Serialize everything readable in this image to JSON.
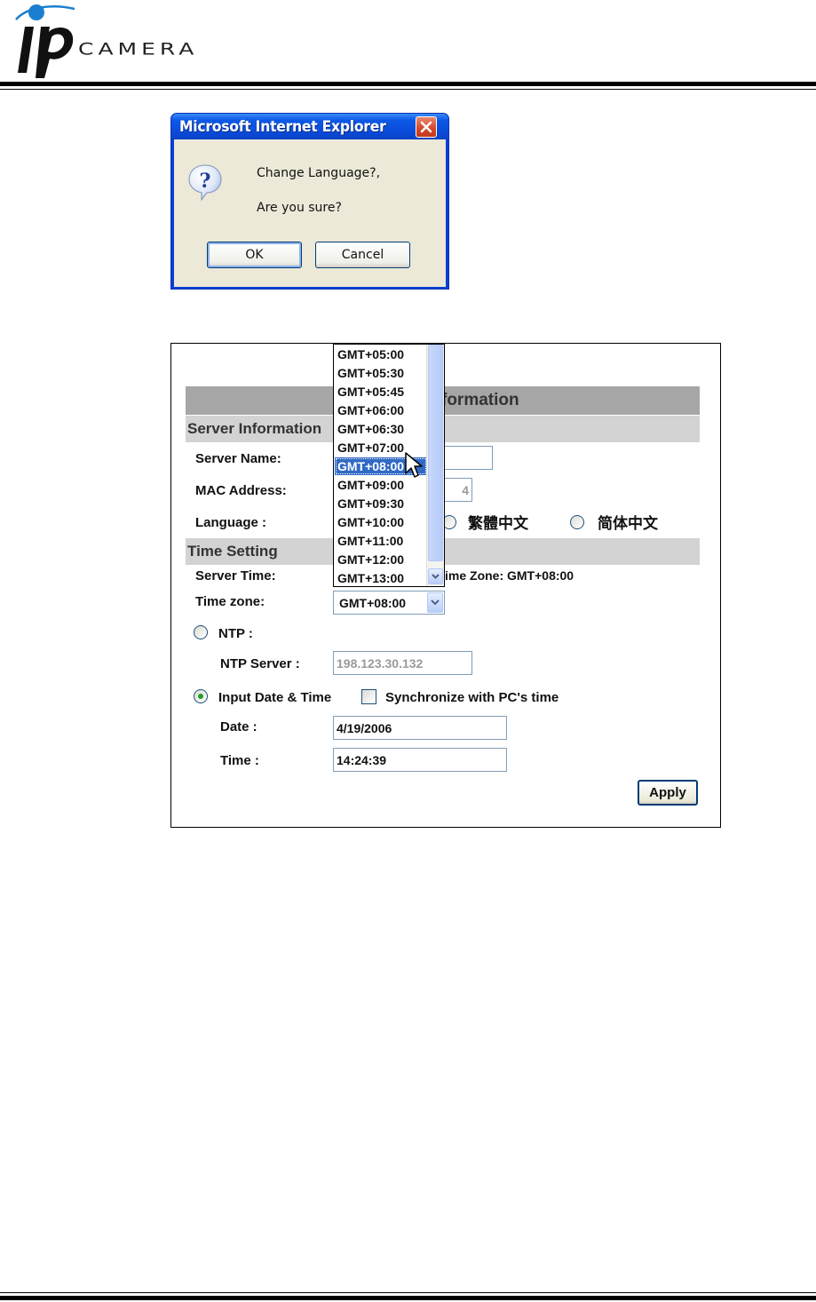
{
  "header": {
    "logo_ip": "ip",
    "logo_text": "CAMERA",
    "logo_dot_color": "#1a7fd0"
  },
  "dialog": {
    "title": "Microsoft Internet Explorer",
    "message_line1": "Change Language?,",
    "message_line2": "Are you sure?",
    "ok_label": "OK",
    "cancel_label": "Cancel",
    "icon": "question-icon",
    "close_icon": "close-icon"
  },
  "panel": {
    "title_bar_text": "formation",
    "server_section": "Server Information",
    "server_name_label": "Server Name:",
    "server_name_value": "",
    "mac_label": "MAC Address:",
    "mac_value": "4",
    "language_label": "Language :",
    "language_options": [
      "繁體中文",
      "简体中文"
    ],
    "time_section": "Time Setting",
    "server_time_label": "Server Time:",
    "server_time_value": "ime Zone: GMT+08:00",
    "timezone_label": "Time zone:",
    "timezone_value": "GMT+08:00",
    "ntp_label": "NTP :",
    "ntp_server_label": "NTP Server :",
    "ntp_server_value": "198.123.30.132",
    "input_dt_label": "Input Date & Time",
    "sync_label": "Synchronize with PC's time",
    "date_label": "Date :",
    "date_value": "4/19/2006",
    "time_label": "Time :",
    "time_value": "14:24:39",
    "apply_label": "Apply",
    "time_mode": "input",
    "sync_checked": false
  },
  "timezone_dropdown": {
    "items": [
      "GMT+05:00",
      "GMT+05:30",
      "GMT+05:45",
      "GMT+06:00",
      "GMT+06:30",
      "GMT+07:00",
      "GMT+08:00",
      "GMT+09:00",
      "GMT+09:30",
      "GMT+10:00",
      "GMT+11:00",
      "GMT+12:00",
      "GMT+13:00"
    ],
    "selected": "GMT+08:00"
  }
}
